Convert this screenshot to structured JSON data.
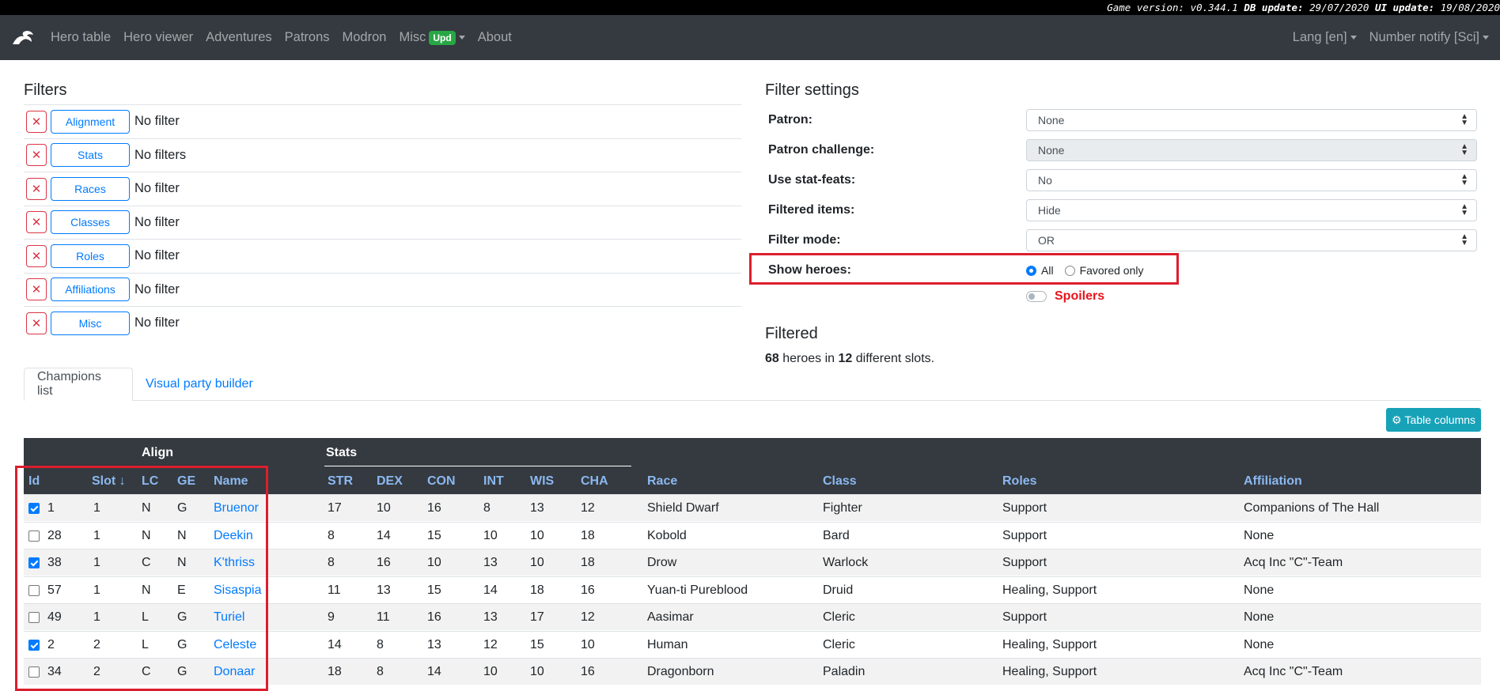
{
  "topbar": {
    "game_label": "Game version:",
    "game_value": "v0.344.1",
    "db_label": "DB update:",
    "db_value": "29/07/2020",
    "ui_label": "UI update:",
    "ui_value": "19/08/2020"
  },
  "navbar": {
    "items": [
      "Hero table",
      "Hero viewer",
      "Adventures",
      "Patrons",
      "Modron",
      "Misc",
      "About"
    ],
    "misc_badge": "Upd",
    "lang": "Lang [en]",
    "number_notify": "Number notify [Sci]"
  },
  "filters": {
    "title": "Filters",
    "rows": [
      {
        "button": "Alignment",
        "value": "No filter"
      },
      {
        "button": "Stats",
        "value": "No filters"
      },
      {
        "button": "Races",
        "value": "No filter"
      },
      {
        "button": "Classes",
        "value": "No filter"
      },
      {
        "button": "Roles",
        "value": "No filter"
      },
      {
        "button": "Affiliations",
        "value": "No filter"
      },
      {
        "button": "Misc",
        "value": "No filter"
      }
    ],
    "remove_glyph": "✕"
  },
  "settings": {
    "title": "Filter settings",
    "patron_label": "Patron:",
    "patron_value": "None",
    "challenge_label": "Patron challenge:",
    "challenge_value": "None",
    "statfeats_label": "Use stat-feats:",
    "statfeats_value": "No",
    "items_label": "Filtered items:",
    "items_value": "Hide",
    "mode_label": "Filter mode:",
    "mode_value": "OR",
    "show_label": "Show heroes:",
    "show_all": "All",
    "show_fav": "Favored only",
    "show_selected": "All",
    "spoilers": "Spoilers"
  },
  "filtered": {
    "title": "Filtered",
    "count": "68",
    "mid": "heroes in",
    "slots": "12",
    "end": "different slots."
  },
  "tabs": {
    "champions": "Champions list",
    "builder": "Visual party builder"
  },
  "table_columns_button": "Table columns",
  "colors": {
    "navbar": "#343a40",
    "primary": "#007bff",
    "danger": "#dc3545",
    "success": "#28a745",
    "info": "#17a2b8",
    "highlight": "#dc1e2d"
  },
  "table": {
    "group_align": "Align",
    "group_stats": "Stats",
    "headers": {
      "id": "Id",
      "slot": "Slot ↓",
      "lc": "LC",
      "ge": "GE",
      "name": "Name",
      "str": "STR",
      "dex": "DEX",
      "con": "CON",
      "int": "INT",
      "wis": "WIS",
      "cha": "CHA",
      "race": "Race",
      "class": "Class",
      "roles": "Roles",
      "affiliation": "Affiliation"
    },
    "rows": [
      {
        "checked": true,
        "id": "1",
        "slot": "1",
        "lc": "N",
        "ge": "G",
        "name": "Bruenor",
        "str": "17",
        "dex": "10",
        "con": "16",
        "int": "8",
        "wis": "13",
        "cha": "12",
        "race": "Shield Dwarf",
        "class": "Fighter",
        "roles": "Support",
        "affiliation": "Companions of The Hall"
      },
      {
        "checked": false,
        "id": "28",
        "slot": "1",
        "lc": "N",
        "ge": "N",
        "name": "Deekin",
        "str": "8",
        "dex": "14",
        "con": "15",
        "int": "10",
        "wis": "10",
        "cha": "18",
        "race": "Kobold",
        "class": "Bard",
        "roles": "Support",
        "affiliation": "None"
      },
      {
        "checked": true,
        "id": "38",
        "slot": "1",
        "lc": "C",
        "ge": "N",
        "name": "K'thriss",
        "str": "8",
        "dex": "16",
        "con": "10",
        "int": "13",
        "wis": "10",
        "cha": "18",
        "race": "Drow",
        "class": "Warlock",
        "roles": "Support",
        "affiliation": "Acq Inc \"C\"-Team"
      },
      {
        "checked": false,
        "id": "57",
        "slot": "1",
        "lc": "N",
        "ge": "E",
        "name": "Sisaspia",
        "str": "11",
        "dex": "13",
        "con": "15",
        "int": "14",
        "wis": "18",
        "cha": "16",
        "race": "Yuan-ti Pureblood",
        "class": "Druid",
        "roles": "Healing, Support",
        "affiliation": "None"
      },
      {
        "checked": false,
        "id": "49",
        "slot": "1",
        "lc": "L",
        "ge": "G",
        "name": "Turiel",
        "str": "9",
        "dex": "11",
        "con": "16",
        "int": "13",
        "wis": "17",
        "cha": "12",
        "race": "Aasimar",
        "class": "Cleric",
        "roles": "Support",
        "affiliation": "None"
      },
      {
        "checked": true,
        "id": "2",
        "slot": "2",
        "lc": "L",
        "ge": "G",
        "name": "Celeste",
        "str": "14",
        "dex": "8",
        "con": "13",
        "int": "12",
        "wis": "15",
        "cha": "10",
        "race": "Human",
        "class": "Cleric",
        "roles": "Healing, Support",
        "affiliation": "None"
      },
      {
        "checked": false,
        "id": "34",
        "slot": "2",
        "lc": "C",
        "ge": "G",
        "name": "Donaar",
        "str": "18",
        "dex": "8",
        "con": "14",
        "int": "10",
        "wis": "10",
        "cha": "16",
        "race": "Dragonborn",
        "class": "Paladin",
        "roles": "Healing, Support",
        "affiliation": "Acq Inc \"C\"-Team"
      }
    ]
  }
}
